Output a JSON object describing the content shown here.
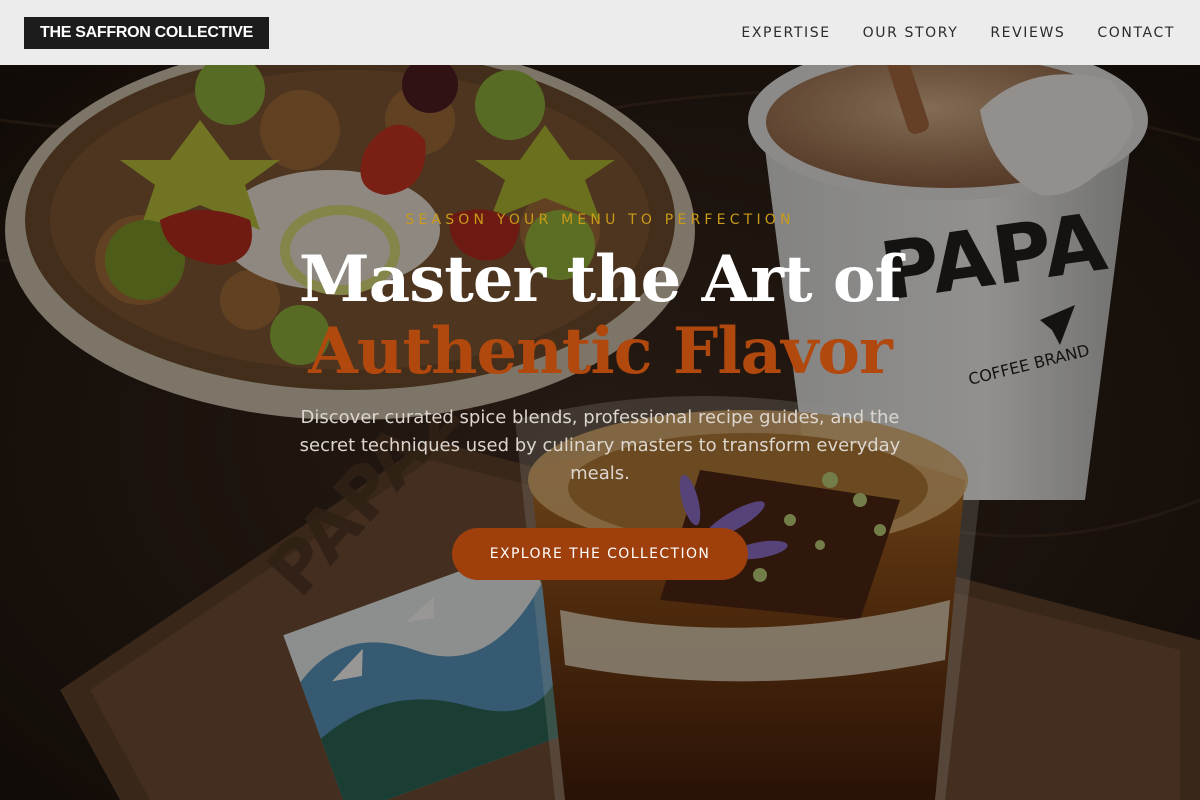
{
  "header": {
    "logo": "THE SAFFRON COLLECTIVE",
    "nav": [
      {
        "label": "EXPERTISE"
      },
      {
        "label": "OUR STORY"
      },
      {
        "label": "REVIEWS"
      },
      {
        "label": "CONTACT"
      }
    ]
  },
  "hero": {
    "background_image": "food-and-coffee-photo",
    "eyebrow": "SEASON YOUR MENU TO PERFECTION",
    "headline_line1": "Master the Art of",
    "headline_line2": "Authentic Flavor",
    "description": "Discover curated spice blends, professional recipe guides, and the secret techniques used by culinary masters to transform everyday meals.",
    "cta_label": "EXPLORE THE COLLECTION",
    "photo_text": {
      "cup_brand": "PAPA",
      "cup_sub": "COFFEE BRAND",
      "tray_brand": "PAPA22"
    }
  },
  "colors": {
    "header_bg": "#ececec",
    "logo_bg": "#1c1c1c",
    "accent_gold": "#c99a18",
    "accent_rust": "#b1480e",
    "cta_bg": "#9e3f0c"
  }
}
